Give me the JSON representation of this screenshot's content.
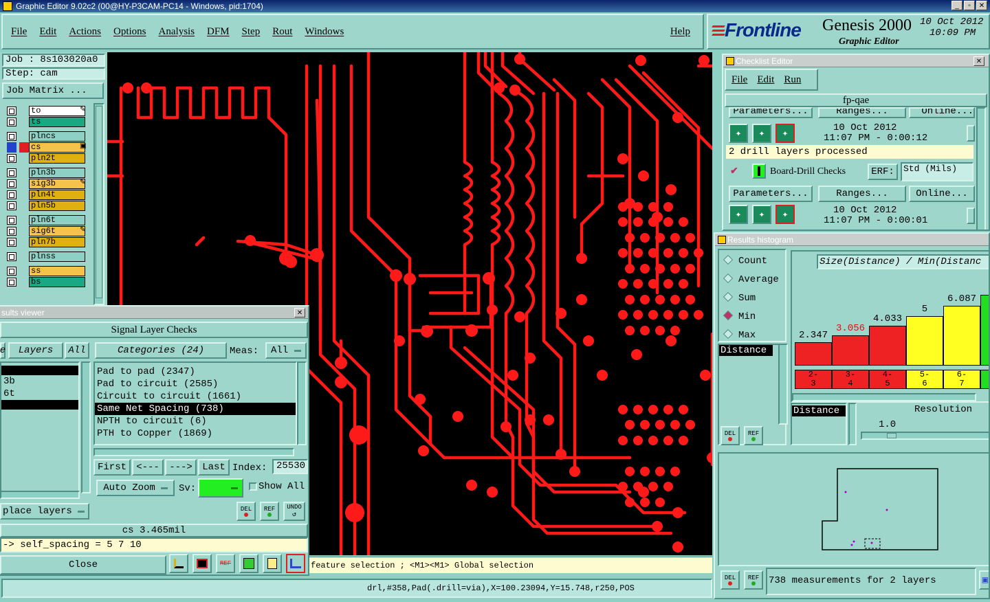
{
  "window": {
    "title": "Graphic Editor 9.02c2 (00@HY-P3CAM-PC14 - Windows, pid:1704)",
    "min": "_",
    "max": "▫",
    "close": "✕"
  },
  "menu": {
    "items": [
      "File",
      "Edit",
      "Actions",
      "Options",
      "Analysis",
      "DFM",
      "Step",
      "Rout",
      "Windows"
    ],
    "help": "Help"
  },
  "brand": {
    "logo": "Frontline",
    "product": "Genesis 2000",
    "subtitle": "Graphic Editor",
    "date": "10 Oct 2012",
    "time": "10:09 PM"
  },
  "job": {
    "job_label": "Job : 8s103020a0",
    "step_label": "Step: cam",
    "matrix_button": "Job Matrix ..."
  },
  "layers": [
    {
      "name": "to",
      "color": "#ffffff",
      "mark": "✎"
    },
    {
      "name": "ts",
      "color": "#1aa882",
      "mark": ""
    },
    {
      "name": "plncs",
      "color": "#8fd0c4",
      "mark": ""
    },
    {
      "name": "cs",
      "color": "#f5c24a",
      "mark": "▣"
    },
    {
      "name": "pln2t",
      "color": "#e0b010",
      "mark": ""
    },
    {
      "name": "pln3b",
      "color": "#8fd0c4",
      "mark": ""
    },
    {
      "name": "sig3b",
      "color": "#f5c24a",
      "mark": "✎"
    },
    {
      "name": "pln4t",
      "color": "#e0b010",
      "mark": ""
    },
    {
      "name": "pln5b",
      "color": "#e0b010",
      "mark": ""
    },
    {
      "name": "pln6t",
      "color": "#8fd0c4",
      "mark": ""
    },
    {
      "name": "sig6t",
      "color": "#f5c24a",
      "mark": "✎"
    },
    {
      "name": "pln7b",
      "color": "#e0b010",
      "mark": ""
    },
    {
      "name": "plnss",
      "color": "#8fd0c4",
      "mark": ""
    },
    {
      "name": "ss",
      "color": "#f5c24a",
      "mark": ""
    },
    {
      "name": "bs",
      "color": "#1aa882",
      "mark": ""
    }
  ],
  "results_viewer": {
    "title": "sults viewer",
    "header": "Signal Layer Checks",
    "tab_partial": "e",
    "tab_layers": "Layers",
    "tab_all": "All",
    "tab_categories": "Categories (24)",
    "meas_label": "Meas:",
    "meas_value": "All",
    "layers_list": [
      "",
      "3b",
      "6t",
      ""
    ],
    "categories": [
      "Pad to pad (2347)",
      "Pad to circuit (2585)",
      "Circuit to circuit (1661)",
      "Same Net Spacing (738)",
      "NPTH to circuit (6)",
      "PTH to Copper (1869)"
    ],
    "btn_first": "First",
    "btn_prev": "<---",
    "btn_next": "--->",
    "btn_last": "Last",
    "index_label": "Index:",
    "index_value": "25530",
    "auto_zoom": "Auto Zoom",
    "sv_label": "Sv:",
    "show_all": "Show All",
    "replace_layers": "place layers",
    "status_value": "cs 3.465mil",
    "formula": "-> self_spacing = 5 7 10",
    "close": "Close",
    "del": "DEL",
    "ref": "REF",
    "undo": "UNDO"
  },
  "checklist": {
    "title": "Checklist Editor",
    "menu": [
      "File",
      "Edit",
      "Run"
    ],
    "name": "fp-qae",
    "tabs": [
      "Parameters...",
      "Ranges...",
      "Online..."
    ],
    "row1_date": "10 Oct 2012",
    "row1_time": "11:07 PM - 0:00:12",
    "processed": "2 drill layers processed",
    "check_name": "Board-Drill Checks",
    "erf_label": "ERF:",
    "erf_value": "Std (Mils)",
    "row2_date": "10 Oct 2012",
    "row2_time": "11:07 PM - 0:00:01"
  },
  "histogram": {
    "title": "Results histogram",
    "modes": [
      "Count",
      "Average",
      "Sum",
      "Min",
      "Max"
    ],
    "selected_mode": "Min",
    "list_label": "Distance",
    "chart_title": "Size(Distance) / Min(Distanc",
    "bars": [
      {
        "label": "2.347",
        "range": "2-\n3",
        "value": 2.347,
        "color": "#ee2222",
        "label_color": "#000000"
      },
      {
        "label": "3.056",
        "range": "3-\n4",
        "value": 3.056,
        "color": "#ee2222",
        "label_color": "#dd1111"
      },
      {
        "label": "4.033",
        "range": "4-\n5",
        "value": 4.033,
        "color": "#ee2222",
        "label_color": "#000000"
      },
      {
        "label": "5",
        "range": "5-\n6",
        "value": 5,
        "color": "#ffff22",
        "label_color": "#000000"
      },
      {
        "label": "6.087",
        "range": "6-\n7",
        "value": 6.087,
        "color": "#ffff22",
        "label_color": "#000000"
      },
      {
        "label": "",
        "range": "",
        "value": 7.2,
        "color": "#22dd22",
        "label_color": "#000000"
      }
    ],
    "distance_label": "Distance",
    "resolution_label": "Resolution",
    "resolution_value": "1.0",
    "measurements": "738 measurements for 2 layers"
  },
  "statusbar": {
    "hint": "feature selection ; <M1><M1> Global selection",
    "coords": "drl,#358,Pad(.drill=via),X=100.23094,Y=15.748,r250,POS"
  },
  "colors": {
    "trace": "#ff1a1a",
    "canvas": "#000000",
    "panel": "#9ed6cb"
  }
}
